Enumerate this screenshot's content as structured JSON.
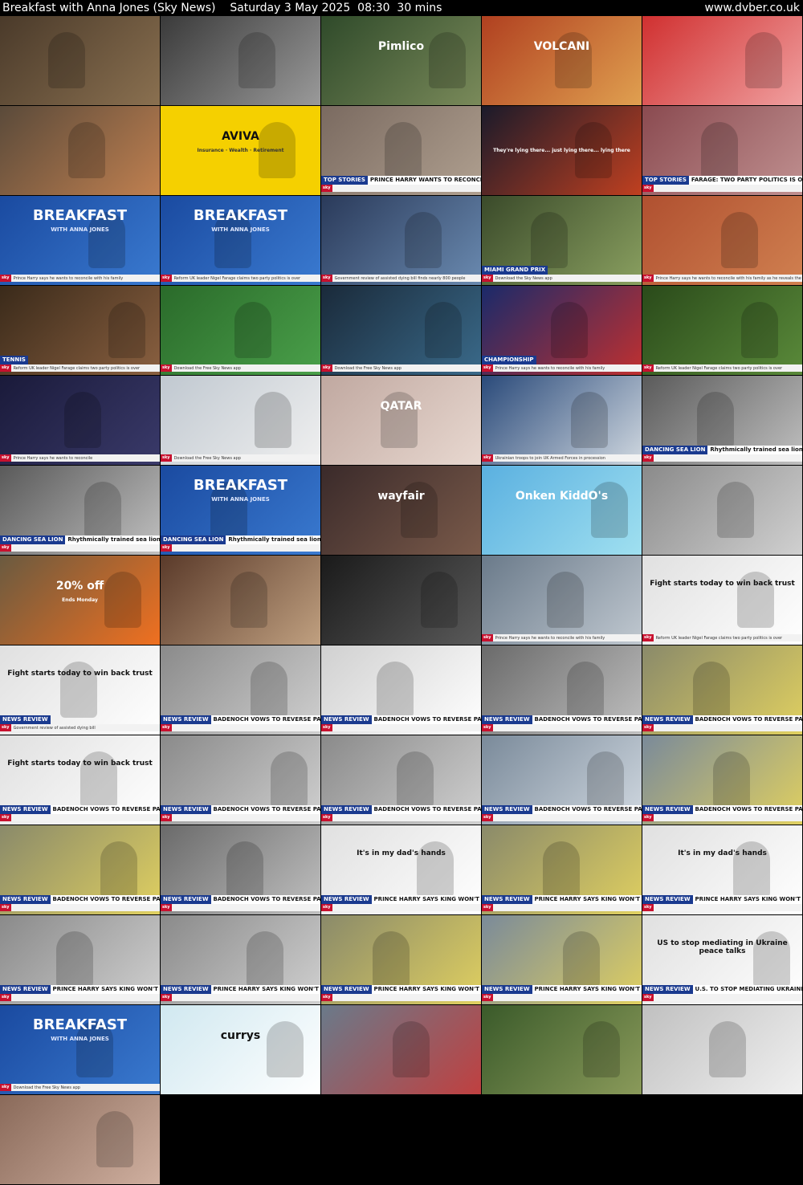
{
  "header": {
    "title": "Breakfast with Anna Jones (Sky News)",
    "date": "Saturday 3 May 2025",
    "time": "08:30",
    "duration": "30 mins",
    "site": "www.dvber.co.uk"
  },
  "tiles": [
    {
      "bg": [
        "#4a3a2a",
        "#8a7050"
      ]
    },
    {
      "bg": [
        "#3a3a3a",
        "#9a9a9a"
      ]
    },
    {
      "bg": [
        "#2f4a2a",
        "#7a8a5a"
      ],
      "caption": "Pimlico"
    },
    {
      "bg": [
        "#b04020",
        "#e0a050"
      ],
      "caption": "VOLCANI"
    },
    {
      "bg": [
        "#d03030",
        "#f0a0a0"
      ]
    },
    {
      "bg": [
        "#5a4a3a",
        "#c08050"
      ]
    },
    {
      "bg": [
        "#f5d000",
        "#f5d000"
      ],
      "caption": "AVIVA",
      "sub": "Insurance · Wealth · Retirement"
    },
    {
      "bg": [
        "#7a6a60",
        "#b0a090"
      ],
      "tag": "TOP STORIES",
      "headline": "PRINCE HARRY WANTS TO RECONCILE"
    },
    {
      "bg": [
        "#1a1a2a",
        "#c04020"
      ],
      "sub": "They're lying there... just lying there... lying there"
    },
    {
      "bg": [
        "#8a4a50",
        "#c09090"
      ],
      "tag": "TOP STORIES",
      "headline": "FARAGE: TWO PARTY POLITICS IS OVER"
    },
    {
      "bg": [
        "#1a4aa0",
        "#3a7ad0"
      ],
      "sky": "BREAKFAST",
      "skysub": "WITH ANNA JONES",
      "ticker": "Prince Harry says he wants to reconcile with his family"
    },
    {
      "bg": [
        "#1a4aa0",
        "#3a7ad0"
      ],
      "sky": "BREAKFAST",
      "skysub": "WITH ANNA JONES",
      "ticker": "Reform UK leader Nigel Farage claims two party politics is over"
    },
    {
      "bg": [
        "#2a3a5a",
        "#6a8ab0"
      ],
      "ticker": "Government review of assisted dying bill finds nearly 800 people"
    },
    {
      "bg": [
        "#3a4a2a",
        "#8aa060"
      ],
      "tag": "MIAMI GRAND PRIX",
      "ticker": "Download the Sky News app"
    },
    {
      "bg": [
        "#b05030",
        "#d08050"
      ],
      "ticker": "Prince Harry says he wants to reconcile with his family as he reveals the breakdown"
    },
    {
      "bg": [
        "#3a2a1a",
        "#8a6040"
      ],
      "tag": "TENNIS",
      "ticker": "Reform UK leader Nigel Farage claims two party politics is over"
    },
    {
      "bg": [
        "#2a6a2a",
        "#4aa04a"
      ],
      "ticker": "Download the Free Sky News app"
    },
    {
      "bg": [
        "#1a2a3a",
        "#3a6a8a"
      ],
      "ticker": "Download the Free Sky News app"
    },
    {
      "bg": [
        "#1a2a6a",
        "#c03030"
      ],
      "tag": "CHAMPIONSHIP",
      "ticker": "Prince Harry says he wants to reconcile with his family"
    },
    {
      "bg": [
        "#2a4a1a",
        "#5a8a3a"
      ],
      "ticker": "Reform UK leader Nigel Farage claims two party politics is over"
    },
    {
      "bg": [
        "#1a1a3a",
        "#3a3a6a"
      ],
      "ticker": "Prince Harry says he wants to reconcile"
    },
    {
      "bg": [
        "#c0c8d0",
        "#f0f0f0"
      ],
      "ticker": "Download the Free Sky News app"
    },
    {
      "bg": [
        "#c0a8a0",
        "#e8d8d0"
      ],
      "caption": "QATAR"
    },
    {
      "bg": [
        "#2a4a7a",
        "#d0d8e0"
      ],
      "ticker": "Ukrainian troops to join UK Armed Forces in procession"
    },
    {
      "bg": [
        "#5a5a5a",
        "#c0c0c0"
      ],
      "tag": "DANCING SEA LION",
      "headline": "Rhythmically trained sea lion 'Ronan' can boogie"
    },
    {
      "bg": [
        "#5a5a5a",
        "#c0c0c0"
      ],
      "tag": "DANCING SEA LION",
      "headline": "Rhythmically trained sea lion 'Ronan' can boogie"
    },
    {
      "bg": [
        "#1a4aa0",
        "#3a7ad0"
      ],
      "sky": "BREAKFAST",
      "skysub": "WITH ANNA JONES",
      "tag": "DANCING SEA LION",
      "headline": "Rhythmically trained sea lion 'Ronan' can boogie"
    },
    {
      "bg": [
        "#3a2a2a",
        "#7a5a4a"
      ],
      "caption": "wayfair"
    },
    {
      "bg": [
        "#5ab0e0",
        "#a0e0f0"
      ],
      "caption": "Onken KiddO's"
    },
    {
      "bg": [
        "#8a8a8a",
        "#d0d0d0"
      ]
    },
    {
      "bg": [
        "#6a5a40",
        "#f07020"
      ],
      "caption": "20% off",
      "sub": "Ends Monday"
    },
    {
      "bg": [
        "#5a3a2a",
        "#c0a080"
      ]
    },
    {
      "bg": [
        "#1a1a1a",
        "#5a5a5a"
      ]
    },
    {
      "bg": [
        "#6a7a8a",
        "#c0c8d0"
      ],
      "ticker": "Prince Harry says he wants to reconcile with his family"
    },
    {
      "bg": [
        "#e0e0e0",
        "#ffffff"
      ],
      "caption": "Fight starts today to win back trust",
      "ticker": "Reform UK leader Nigel Farage claims two party politics is over"
    },
    {
      "bg": [
        "#e0e0e0",
        "#ffffff"
      ],
      "caption": "Fight starts today to win back trust",
      "tag": "NEWS REVIEW",
      "ticker": "Government review of assisted dying bill"
    },
    {
      "bg": [
        "#8a8a8a",
        "#d0d0d0"
      ],
      "tag": "NEWS REVIEW",
      "headline": "BADENOCH VOWS TO REVERSE PARTY FORTUNES"
    },
    {
      "bg": [
        "#d0d0d0",
        "#ffffff"
      ],
      "tag": "NEWS REVIEW",
      "headline": "BADENOCH VOWS TO REVERSE PARTY FORTUNES"
    },
    {
      "bg": [
        "#6a6a6a",
        "#c0c0c0"
      ],
      "tag": "NEWS REVIEW",
      "headline": "BADENOCH VOWS TO REVERSE PARTY FORTUNES"
    },
    {
      "bg": [
        "#8a8a6a",
        "#e0d060"
      ],
      "tag": "NEWS REVIEW",
      "headline": "BADENOCH VOWS TO REVERSE PARTY FORTUNES"
    },
    {
      "bg": [
        "#e0e0e0",
        "#ffffff"
      ],
      "caption": "Fight starts today to win back trust",
      "tag": "NEWS REVIEW",
      "headline": "BADENOCH VOWS TO REVERSE PARTY FORTUNES"
    },
    {
      "bg": [
        "#8a8a8a",
        "#d0d0d0"
      ],
      "tag": "NEWS REVIEW",
      "headline": "BADENOCH VOWS TO REVERSE PARTY FORTUNES"
    },
    {
      "bg": [
        "#8a8a8a",
        "#d0d0d0"
      ],
      "tag": "NEWS REVIEW",
      "headline": "BADENOCH VOWS TO REVERSE PARTY FORTUNES"
    },
    {
      "bg": [
        "#7a8a9a",
        "#d0d8e0"
      ],
      "tag": "NEWS REVIEW",
      "headline": "BADENOCH VOWS TO REVERSE PARTY FORTUNES"
    },
    {
      "bg": [
        "#7a8a9a",
        "#e0d060"
      ],
      "tag": "NEWS REVIEW",
      "headline": "BADENOCH VOWS TO REVERSE PARTY FORTUNES"
    },
    {
      "bg": [
        "#8a8a6a",
        "#e0d060"
      ],
      "tag": "NEWS REVIEW",
      "headline": "BADENOCH VOWS TO REVERSE PARTY FORTUNES"
    },
    {
      "bg": [
        "#6a6a6a",
        "#c0c0c0"
      ],
      "tag": "NEWS REVIEW",
      "headline": "BADENOCH VOWS TO REVERSE PARTY FORTUNES"
    },
    {
      "bg": [
        "#e0e0e0",
        "#ffffff"
      ],
      "caption": "It's in my dad's hands",
      "tag": "NEWS REVIEW",
      "headline": "PRINCE HARRY SAYS KING WON'T SPEAK TO HIM"
    },
    {
      "bg": [
        "#8a8a6a",
        "#e0d060"
      ],
      "tag": "NEWS REVIEW",
      "headline": "PRINCE HARRY SAYS KING WON'T SPEAK TO HIM"
    },
    {
      "bg": [
        "#e0e0e0",
        "#ffffff"
      ],
      "caption": "It's in my dad's hands",
      "tag": "NEWS REVIEW",
      "headline": "PRINCE HARRY SAYS KING WON'T SPEAK TO HIM"
    },
    {
      "bg": [
        "#8a8a8a",
        "#d0d0d0"
      ],
      "tag": "NEWS REVIEW",
      "headline": "PRINCE HARRY SAYS KING WON'T SPEAK TO HIM"
    },
    {
      "bg": [
        "#8a8a8a",
        "#d0d0d0"
      ],
      "tag": "NEWS REVIEW",
      "headline": "PRINCE HARRY SAYS KING WON'T SPEAK TO HIM"
    },
    {
      "bg": [
        "#8a8a6a",
        "#e0d060"
      ],
      "tag": "NEWS REVIEW",
      "headline": "PRINCE HARRY SAYS KING WON'T SPEAK TO HIM"
    },
    {
      "bg": [
        "#7a8a9a",
        "#e0d060"
      ],
      "tag": "NEWS REVIEW",
      "headline": "PRINCE HARRY SAYS KING WON'T SPEAK TO HIM"
    },
    {
      "bg": [
        "#e0e0e0",
        "#ffffff"
      ],
      "caption": "US to stop mediating in Ukraine peace talks",
      "tag": "NEWS REVIEW",
      "headline": "U.S. TO STOP MEDIATING UKRAINE PEACE TALKS"
    },
    {
      "bg": [
        "#1a4aa0",
        "#3a7ad0"
      ],
      "sky": "BREAKFAST",
      "skysub": "WITH ANNA JONES",
      "ticker": "Download the Free Sky News app"
    },
    {
      "bg": [
        "#d0e8f0",
        "#ffffff"
      ],
      "caption": "currys"
    },
    {
      "bg": [
        "#6a7a8a",
        "#c04040"
      ]
    },
    {
      "bg": [
        "#3a5a2a",
        "#8a9a5a"
      ]
    },
    {
      "bg": [
        "#c0c0c0",
        "#f0f0f0"
      ]
    },
    {
      "bg": [
        "#8a6a5a",
        "#d0b0a0"
      ]
    }
  ]
}
